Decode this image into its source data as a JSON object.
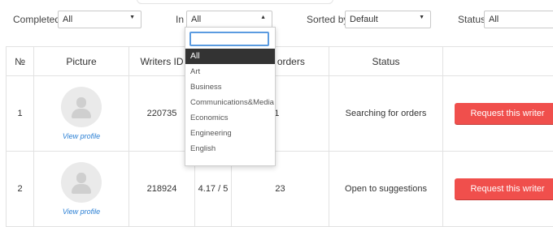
{
  "filters": {
    "completed_label": "Completed",
    "completed_value": "All",
    "in_label": "In",
    "in_value": "All",
    "sorted_label": "Sorted by",
    "sorted_value": "Default",
    "status_label": "Status",
    "status_value": "All"
  },
  "dropdown": {
    "search_value": "",
    "options": [
      "All",
      "Art",
      "Business",
      "Communications&Media",
      "Economics",
      "Engineering",
      "English"
    ],
    "selected": "All"
  },
  "table": {
    "headers": [
      "№",
      "Picture",
      "Writers ID",
      "",
      "eted orders",
      "Status",
      ""
    ],
    "rows": [
      {
        "num": "1",
        "view": "View profile",
        "id": "220735",
        "rating": "",
        "orders": "231",
        "status": "Searching for orders",
        "button": "Request this writer"
      },
      {
        "num": "2",
        "view": "View profile",
        "id": "218924",
        "rating": "4.17 / 5",
        "orders": "23",
        "status": "Open to suggestions",
        "button": "Request this writer"
      }
    ]
  },
  "colors": {
    "button": "#f04f4c",
    "status_searching": "#8fa1c4",
    "status_open": "#58b32c",
    "link": "#2a7fd4",
    "selected_option_bg": "#333333"
  }
}
